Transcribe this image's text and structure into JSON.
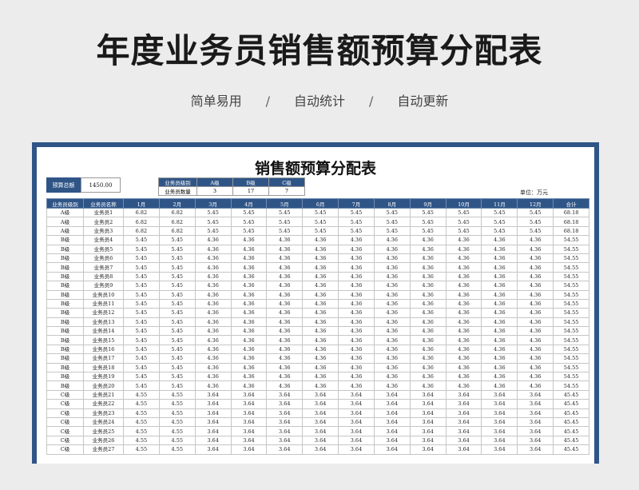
{
  "hero_title": "年度业务员销售额预算分配表",
  "subtitle": {
    "items": [
      "简单易用",
      "自动统计",
      "自动更新"
    ],
    "separator": "/"
  },
  "sheet": {
    "title": "销售额预算分配表",
    "budget_label": "预算总额",
    "budget_value": "1450.00",
    "level_table": {
      "header_label": "业务员级别",
      "levels": [
        "A级",
        "B级",
        "C级"
      ],
      "count_label": "业务员数量",
      "counts": [
        "3",
        "17",
        "7"
      ]
    },
    "unit": "单位：万元",
    "columns": [
      "业务员级别",
      "业务员名称",
      "1月",
      "2月",
      "3月",
      "4月",
      "5月",
      "6月",
      "7月",
      "8月",
      "9月",
      "10月",
      "11月",
      "12月",
      "合计"
    ],
    "rows": [
      [
        "A级",
        "业务员1",
        "6.82",
        "6.82",
        "5.45",
        "5.45",
        "5.45",
        "5.45",
        "5.45",
        "5.45",
        "5.45",
        "5.45",
        "5.45",
        "5.45",
        "68.18"
      ],
      [
        "A级",
        "业务员2",
        "6.82",
        "6.82",
        "5.45",
        "5.45",
        "5.45",
        "5.45",
        "5.45",
        "5.45",
        "5.45",
        "5.45",
        "5.45",
        "5.45",
        "68.18"
      ],
      [
        "A级",
        "业务员3",
        "6.82",
        "6.82",
        "5.45",
        "5.45",
        "5.45",
        "5.45",
        "5.45",
        "5.45",
        "5.45",
        "5.45",
        "5.45",
        "5.45",
        "68.18"
      ],
      [
        "B级",
        "业务员4",
        "5.45",
        "5.45",
        "4.36",
        "4.36",
        "4.36",
        "4.36",
        "4.36",
        "4.36",
        "4.36",
        "4.36",
        "4.36",
        "4.36",
        "54.55"
      ],
      [
        "B级",
        "业务员5",
        "5.45",
        "5.45",
        "4.36",
        "4.36",
        "4.36",
        "4.36",
        "4.36",
        "4.36",
        "4.36",
        "4.36",
        "4.36",
        "4.36",
        "54.55"
      ],
      [
        "B级",
        "业务员6",
        "5.45",
        "5.45",
        "4.36",
        "4.36",
        "4.36",
        "4.36",
        "4.36",
        "4.36",
        "4.36",
        "4.36",
        "4.36",
        "4.36",
        "54.55"
      ],
      [
        "B级",
        "业务员7",
        "5.45",
        "5.45",
        "4.36",
        "4.36",
        "4.36",
        "4.36",
        "4.36",
        "4.36",
        "4.36",
        "4.36",
        "4.36",
        "4.36",
        "54.55"
      ],
      [
        "B级",
        "业务员8",
        "5.45",
        "5.45",
        "4.36",
        "4.36",
        "4.36",
        "4.36",
        "4.36",
        "4.36",
        "4.36",
        "4.36",
        "4.36",
        "4.36",
        "54.55"
      ],
      [
        "B级",
        "业务员9",
        "5.45",
        "5.45",
        "4.36",
        "4.36",
        "4.36",
        "4.36",
        "4.36",
        "4.36",
        "4.36",
        "4.36",
        "4.36",
        "4.36",
        "54.55"
      ],
      [
        "B级",
        "业务员10",
        "5.45",
        "5.45",
        "4.36",
        "4.36",
        "4.36",
        "4.36",
        "4.36",
        "4.36",
        "4.36",
        "4.36",
        "4.36",
        "4.36",
        "54.55"
      ],
      [
        "B级",
        "业务员11",
        "5.45",
        "5.45",
        "4.36",
        "4.36",
        "4.36",
        "4.36",
        "4.36",
        "4.36",
        "4.36",
        "4.36",
        "4.36",
        "4.36",
        "54.55"
      ],
      [
        "B级",
        "业务员12",
        "5.45",
        "5.45",
        "4.36",
        "4.36",
        "4.36",
        "4.36",
        "4.36",
        "4.36",
        "4.36",
        "4.36",
        "4.36",
        "4.36",
        "54.55"
      ],
      [
        "B级",
        "业务员13",
        "5.45",
        "5.45",
        "4.36",
        "4.36",
        "4.36",
        "4.36",
        "4.36",
        "4.36",
        "4.36",
        "4.36",
        "4.36",
        "4.36",
        "54.55"
      ],
      [
        "B级",
        "业务员14",
        "5.45",
        "5.45",
        "4.36",
        "4.36",
        "4.36",
        "4.36",
        "4.36",
        "4.36",
        "4.36",
        "4.36",
        "4.36",
        "4.36",
        "54.55"
      ],
      [
        "B级",
        "业务员15",
        "5.45",
        "5.45",
        "4.36",
        "4.36",
        "4.36",
        "4.36",
        "4.36",
        "4.36",
        "4.36",
        "4.36",
        "4.36",
        "4.36",
        "54.55"
      ],
      [
        "B级",
        "业务员16",
        "5.45",
        "5.45",
        "4.36",
        "4.36",
        "4.36",
        "4.36",
        "4.36",
        "4.36",
        "4.36",
        "4.36",
        "4.36",
        "4.36",
        "54.55"
      ],
      [
        "B级",
        "业务员17",
        "5.45",
        "5.45",
        "4.36",
        "4.36",
        "4.36",
        "4.36",
        "4.36",
        "4.36",
        "4.36",
        "4.36",
        "4.36",
        "4.36",
        "54.55"
      ],
      [
        "B级",
        "业务员18",
        "5.45",
        "5.45",
        "4.36",
        "4.36",
        "4.36",
        "4.36",
        "4.36",
        "4.36",
        "4.36",
        "4.36",
        "4.36",
        "4.36",
        "54.55"
      ],
      [
        "B级",
        "业务员19",
        "5.45",
        "5.45",
        "4.36",
        "4.36",
        "4.36",
        "4.36",
        "4.36",
        "4.36",
        "4.36",
        "4.36",
        "4.36",
        "4.36",
        "54.55"
      ],
      [
        "B级",
        "业务员20",
        "5.45",
        "5.45",
        "4.36",
        "4.36",
        "4.36",
        "4.36",
        "4.36",
        "4.36",
        "4.36",
        "4.36",
        "4.36",
        "4.36",
        "54.55"
      ],
      [
        "C级",
        "业务员21",
        "4.55",
        "4.55",
        "3.64",
        "3.64",
        "3.64",
        "3.64",
        "3.64",
        "3.64",
        "3.64",
        "3.64",
        "3.64",
        "3.64",
        "45.45"
      ],
      [
        "C级",
        "业务员22",
        "4.55",
        "4.55",
        "3.64",
        "3.64",
        "3.64",
        "3.64",
        "3.64",
        "3.64",
        "3.64",
        "3.64",
        "3.64",
        "3.64",
        "45.45"
      ],
      [
        "C级",
        "业务员23",
        "4.55",
        "4.55",
        "3.64",
        "3.64",
        "3.64",
        "3.64",
        "3.64",
        "3.64",
        "3.64",
        "3.64",
        "3.64",
        "3.64",
        "45.45"
      ],
      [
        "C级",
        "业务员24",
        "4.55",
        "4.55",
        "3.64",
        "3.64",
        "3.64",
        "3.64",
        "3.64",
        "3.64",
        "3.64",
        "3.64",
        "3.64",
        "3.64",
        "45.45"
      ],
      [
        "C级",
        "业务员25",
        "4.55",
        "4.55",
        "3.64",
        "3.64",
        "3.64",
        "3.64",
        "3.64",
        "3.64",
        "3.64",
        "3.64",
        "3.64",
        "3.64",
        "45.45"
      ],
      [
        "C级",
        "业务员26",
        "4.55",
        "4.55",
        "3.64",
        "3.64",
        "3.64",
        "3.64",
        "3.64",
        "3.64",
        "3.64",
        "3.64",
        "3.64",
        "3.64",
        "45.45"
      ],
      [
        "C级",
        "业务员27",
        "4.55",
        "4.55",
        "3.64",
        "3.64",
        "3.64",
        "3.64",
        "3.64",
        "3.64",
        "3.64",
        "3.64",
        "3.64",
        "3.64",
        "45.45"
      ]
    ]
  },
  "colors": {
    "header_blue": "#2f5587",
    "background": "#ececec"
  }
}
